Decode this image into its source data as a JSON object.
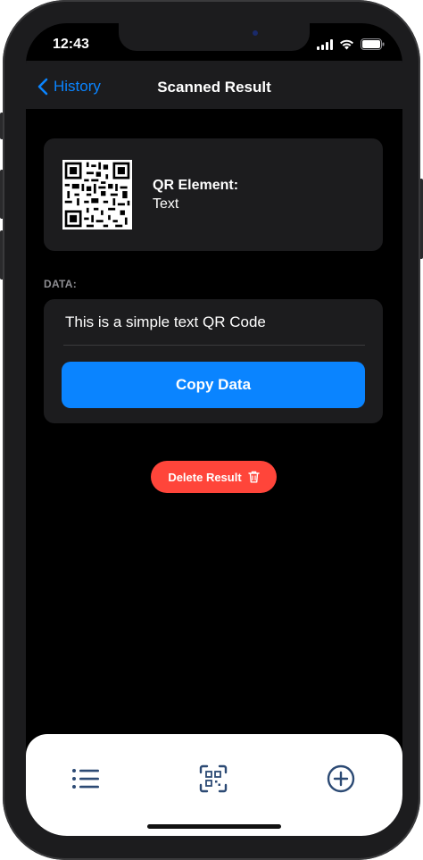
{
  "status_bar": {
    "time": "12:43"
  },
  "nav": {
    "back_label": "History",
    "title": "Scanned Result"
  },
  "result": {
    "element_label": "QR Element:",
    "element_value": "Text"
  },
  "data_section": {
    "label": "DATA:",
    "text": "This is a simple text QR Code",
    "copy_label": "Copy Data"
  },
  "actions": {
    "delete_label": "Delete Result"
  },
  "tabbar": {
    "items": [
      "list-icon",
      "qr-scan-icon",
      "plus-circle-icon"
    ]
  },
  "colors": {
    "accent": "#0a84ff",
    "danger": "#ff453a",
    "card": "#1c1c1e",
    "background": "#000000",
    "tab_icon": "#3c5a80"
  }
}
